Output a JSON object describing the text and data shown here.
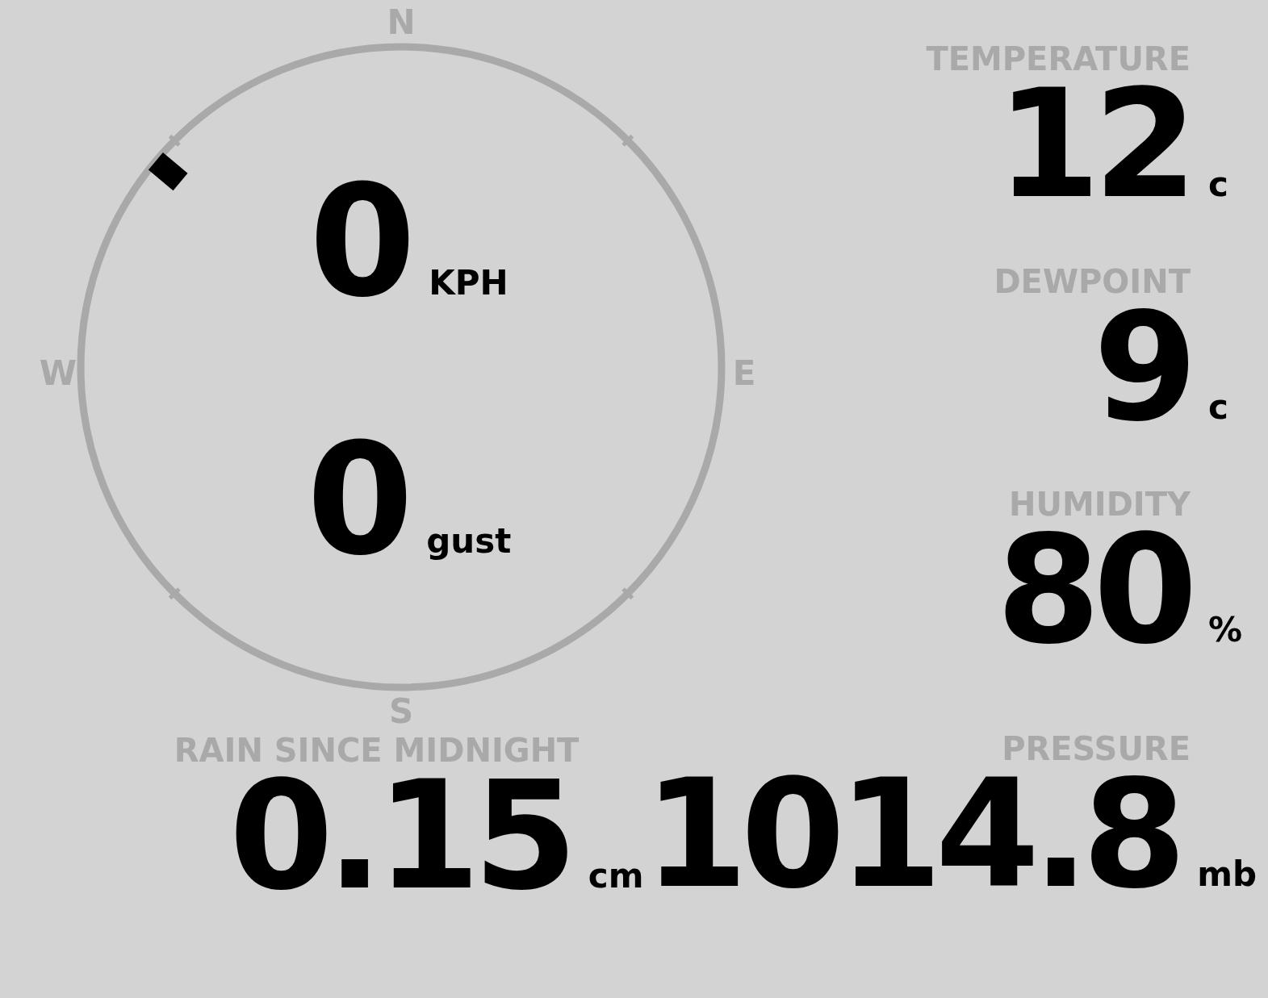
{
  "compass": {
    "labels": [
      {
        "text": "N",
        "kind": "north"
      },
      {
        "text": "E",
        "kind": "east"
      },
      {
        "text": "S",
        "kind": "south"
      },
      {
        "text": "W",
        "kind": "west"
      }
    ],
    "direction": {
      "kind": "northwest"
    }
  },
  "wind": {
    "speed": {
      "value": "0",
      "unit": "KPH"
    },
    "gust": {
      "value": "0",
      "unit": "gust"
    }
  },
  "readings": [
    {
      "label": "TEMPERATURE",
      "value": "12",
      "unit": "c"
    },
    {
      "label": "DEWPOINT",
      "value": "9",
      "unit": "c"
    },
    {
      "label": "HUMIDITY",
      "value": "80",
      "unit": "%"
    }
  ],
  "rain": {
    "label": "RAIN SINCE MIDNIGHT",
    "value": "0.15",
    "unit": "cm"
  },
  "pressure": {
    "label": "PRESSURE",
    "value": "1014.8",
    "unit": "mb"
  }
}
